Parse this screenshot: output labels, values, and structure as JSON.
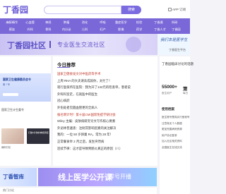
{
  "header": {
    "logo": "丁香园",
    "search_button": "搜索",
    "right_links": "APP  订阅"
  },
  "nav": {
    "items": [
      "麻醉精华",
      "心血管",
      "神经",
      "肿瘤",
      "消化",
      "呼吸",
      "重症医学",
      "检验",
      "感染",
      "外科",
      "骨科",
      "内分泌",
      "儿科",
      "妇产",
      "影像",
      "药学"
    ],
    "right_items": [
      "丁香通",
      "科研",
      "丁香人才",
      "丁香园"
    ]
  },
  "banner": {
    "title": "丁香园社区",
    "subtitle": "专业医生交流社区"
  },
  "side_ad": {
    "text": "我们本是医学生",
    "sub": "丁香医生平台"
  },
  "left": {
    "slide_title": "国家卫生健康委员会令",
    "slide_sub": "第 7 号",
    "caption": "国家卫生计生委令",
    "thumb2_text": "打破2分钟的神经调控",
    "thumb1_caption": "病例讨论"
  },
  "news": {
    "title": "今日推荐",
    "items": [
      "国家卫健委发文对中医药等手术",
      "上周 RHA 的大夫请去成就你，太忙了！",
      "现行医保所在医院：我为开了132元的检查单，患者说",
      "外科科室走，在就医中的医生",
      "冠心病药",
      "外伤处者见圆血管更的全病人",
      "报名倒计时！第十届CMI国际免疫学研讨会",
      "Wiley 主编：皮肤病研究论文写作核心要素",
      "外泌体普遍查：注射其影响因素的关注解决",
      "我的：一位 50 岁卵巢 RA，常为 28 年！",
      "正常餐食举 2 月之后，发生突然病",
      "连续节律：这才是导致胃肠炎真正的原因（八）"
    ]
  },
  "right": {
    "title": "丁香园临床讨论的话题",
    "stat1": "55000+",
    "stat2": "第",
    "label1": "医生用户",
    "label2": "每日",
    "section": "使用档案",
    "rules": [
      "医生账号是真实行医帐号",
      "注意真实个人数据",
      "更加完善病例资源",
      "用户协议登录",
      "加入社区相关资料",
      "全国医生在线交流"
    ]
  },
  "bottom": {
    "left_text": "丁香智库",
    "banner_text": "线上医学公开课",
    "banner_sub": "零号开播",
    "strip_text": "热门讨论"
  }
}
